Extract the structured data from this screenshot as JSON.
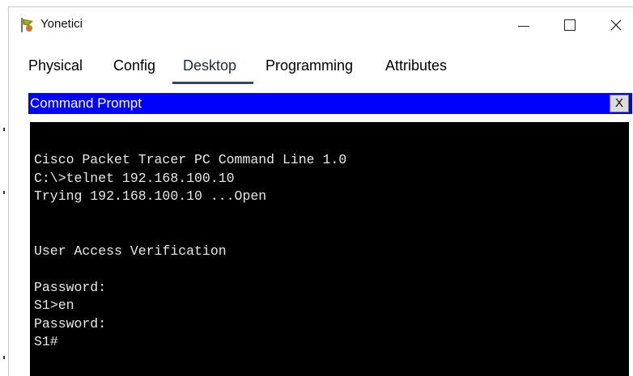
{
  "window": {
    "title": "Yonetici",
    "icon": "packet-tracer-pc-icon",
    "controls": {
      "minimize": "—",
      "maximize": "□",
      "close": "✕"
    }
  },
  "tabs": [
    {
      "label": "Physical",
      "active": false
    },
    {
      "label": "Config",
      "active": false
    },
    {
      "label": "Desktop",
      "active": true
    },
    {
      "label": "Programming",
      "active": false
    },
    {
      "label": "Attributes",
      "active": false
    }
  ],
  "command_prompt": {
    "title": "Command Prompt",
    "close_label": "X",
    "header_color": "#0000ff",
    "lines": [
      "Cisco Packet Tracer PC Command Line 1.0",
      "C:\\>telnet 192.168.100.10",
      "Trying 192.168.100.10 ...Open",
      "",
      "",
      "User Access Verification",
      "",
      "Password:",
      "S1>en",
      "Password:",
      "S1#"
    ]
  }
}
